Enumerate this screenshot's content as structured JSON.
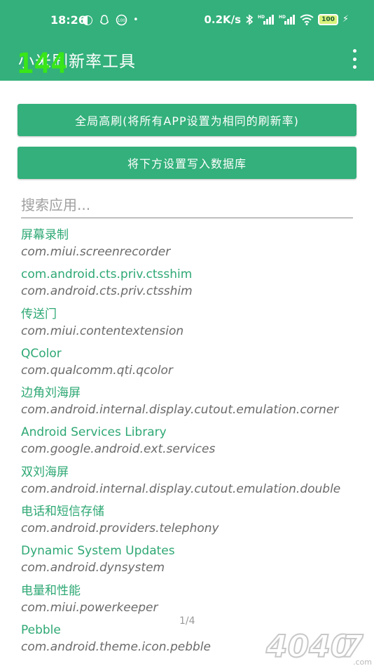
{
  "status_bar": {
    "time": "18:26",
    "network_speed": "0.2K/s",
    "battery": "100",
    "hd1": "HD",
    "hd2": "HD"
  },
  "appbar": {
    "title": "小米刷新率工具",
    "fps_overlay": "144"
  },
  "buttons": {
    "global_high_refresh": "全局高刷(将所有APP设置为相同的刷新率)",
    "write_db": "将下方设置写入数据库"
  },
  "search": {
    "placeholder": "搜索应用..."
  },
  "apps": [
    {
      "name": "屏幕录制",
      "package": "com.miui.screenrecorder"
    },
    {
      "name": "com.android.cts.priv.ctsshim",
      "package": "com.android.cts.priv.ctsshim"
    },
    {
      "name": "传送门",
      "package": "com.miui.contentextension"
    },
    {
      "name": "QColor",
      "package": "com.qualcomm.qti.qcolor"
    },
    {
      "name": "边角刘海屏",
      "package": "com.android.internal.display.cutout.emulation.corner"
    },
    {
      "name": "Android Services Library",
      "package": "com.google.android.ext.services"
    },
    {
      "name": "双刘海屏",
      "package": "com.android.internal.display.cutout.emulation.double"
    },
    {
      "name": "电话和短信存储",
      "package": "com.android.providers.telephony"
    },
    {
      "name": "Dynamic System Updates",
      "package": "com.android.dynsystem"
    },
    {
      "name": "电量和性能",
      "package": "com.miui.powerkeeper"
    },
    {
      "name": "Pebble",
      "package": "com.android.theme.icon.pebble"
    }
  ],
  "pager": "1/4",
  "watermark": {
    "text": "4040",
    "suffix": "7",
    "domain": ".com"
  },
  "colors": {
    "primary": "#33b07b",
    "name_text": "#2ea874",
    "fps_overlay": "#39e619"
  }
}
